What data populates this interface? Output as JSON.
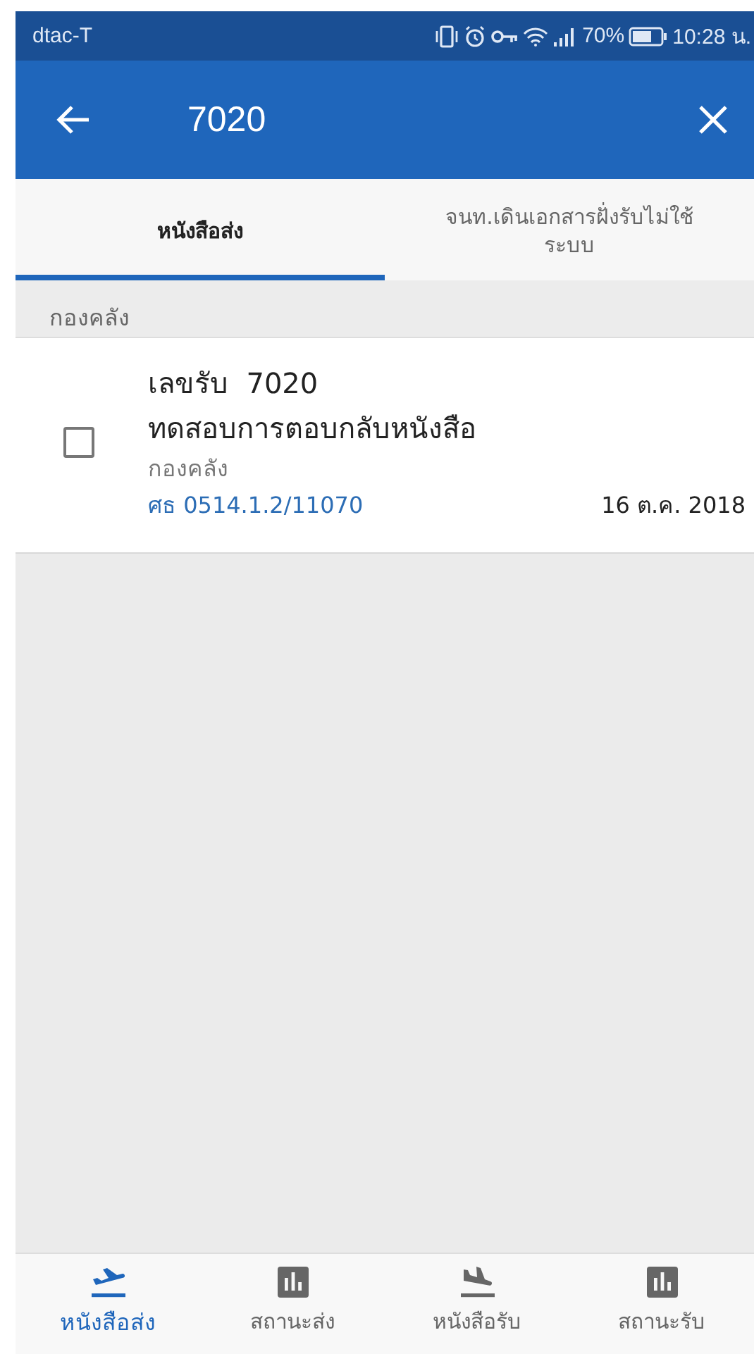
{
  "status_bar": {
    "carrier": "dtac-T",
    "battery_text": "70%",
    "time": "10:28 น."
  },
  "app_bar": {
    "query": "7020"
  },
  "tabs": [
    {
      "label": "หนังสือส่ง",
      "selected": true
    },
    {
      "label": "จนท.เดินเอกสารฝั่งรับไม่ใช้ระบบ",
      "selected": false
    }
  ],
  "groups": [
    {
      "header": "กองคลัง",
      "items": [
        {
          "number_label": "เลขรับ",
          "number": "7020",
          "title": "ทดสอบการตอบกลับหนังสือ",
          "department": "กองคลัง",
          "reference": "ศธ 0514.1.2/11070",
          "date": "16 ต.ค. 2018",
          "checked": false
        }
      ]
    }
  ],
  "bottom_nav": [
    {
      "label": "หนังสือส่ง",
      "kind": "departure",
      "selected": true
    },
    {
      "label": "สถานะส่ง",
      "kind": "chart",
      "selected": false
    },
    {
      "label": "หนังสือรับ",
      "kind": "arrival",
      "selected": false
    },
    {
      "label": "สถานะรับ",
      "kind": "chart",
      "selected": false
    }
  ]
}
